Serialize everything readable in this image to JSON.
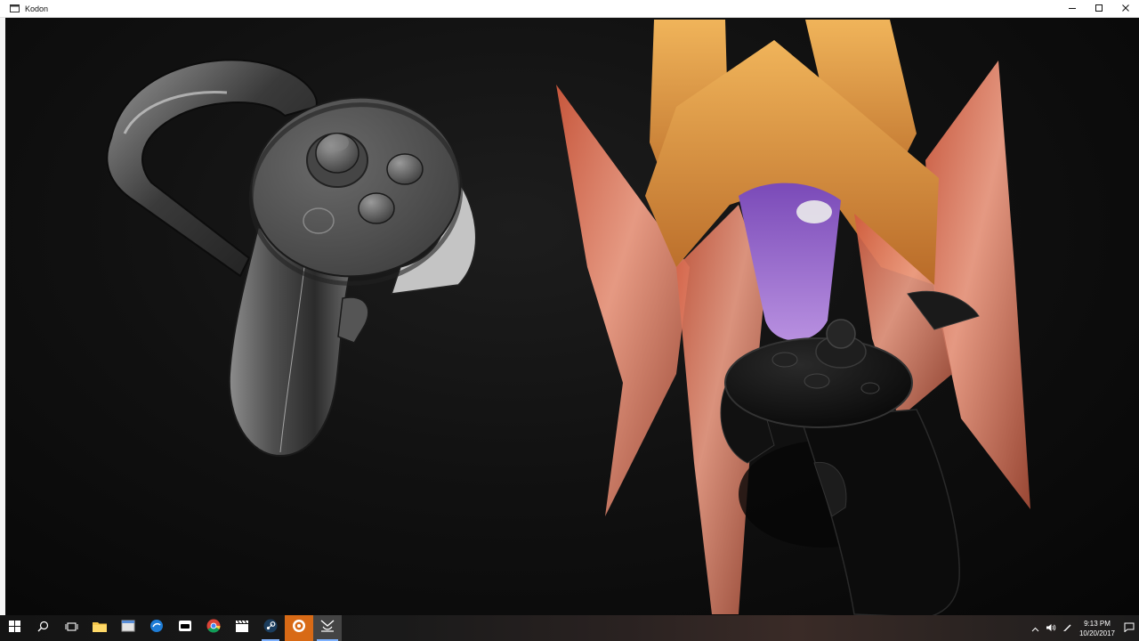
{
  "window": {
    "title": "Kodon",
    "icons": {
      "app": "kodon-app-icon",
      "minimize": "minimize-icon",
      "maximize": "maximize-icon",
      "close": "close-icon"
    }
  },
  "viewport": {
    "content": "3d-scene",
    "objects": [
      "white-vr-touch-controller",
      "black-vr-touch-controller",
      "sculpted-flame-shape"
    ],
    "colors": {
      "flame_orange": "#e8a248",
      "flame_pink": "#e88a78",
      "flame_purple": "#9a5fd0",
      "background": "#0a0a0a"
    }
  },
  "taskbar": {
    "items": [
      {
        "id": "start",
        "icon": "windows-start-icon",
        "state": "normal"
      },
      {
        "id": "search",
        "icon": "search-icon",
        "state": "normal"
      },
      {
        "id": "task-view",
        "icon": "task-view-icon",
        "state": "normal"
      },
      {
        "id": "file-explorer",
        "icon": "folder-icon",
        "state": "normal"
      },
      {
        "id": "app-2",
        "icon": "app-window-icon",
        "state": "normal"
      },
      {
        "id": "app-3",
        "icon": "blue-circle-app-icon",
        "state": "normal"
      },
      {
        "id": "app-4",
        "icon": "headset-app-icon",
        "state": "normal"
      },
      {
        "id": "chrome",
        "icon": "chrome-icon",
        "state": "normal"
      },
      {
        "id": "app-6",
        "icon": "clapperboard-icon",
        "state": "normal"
      },
      {
        "id": "steam",
        "icon": "steam-icon",
        "state": "running"
      },
      {
        "id": "app-8",
        "icon": "orange-circle-app-icon",
        "state": "orange"
      },
      {
        "id": "kodon",
        "icon": "kodon-taskbar-icon",
        "state": "active"
      }
    ],
    "tray": {
      "icons": [
        "chevron-up-icon",
        "volume-icon",
        "pen-icon"
      ],
      "time": "9:13 PM",
      "date": "10/20/2017",
      "notification_icon": "notification-icon"
    }
  }
}
